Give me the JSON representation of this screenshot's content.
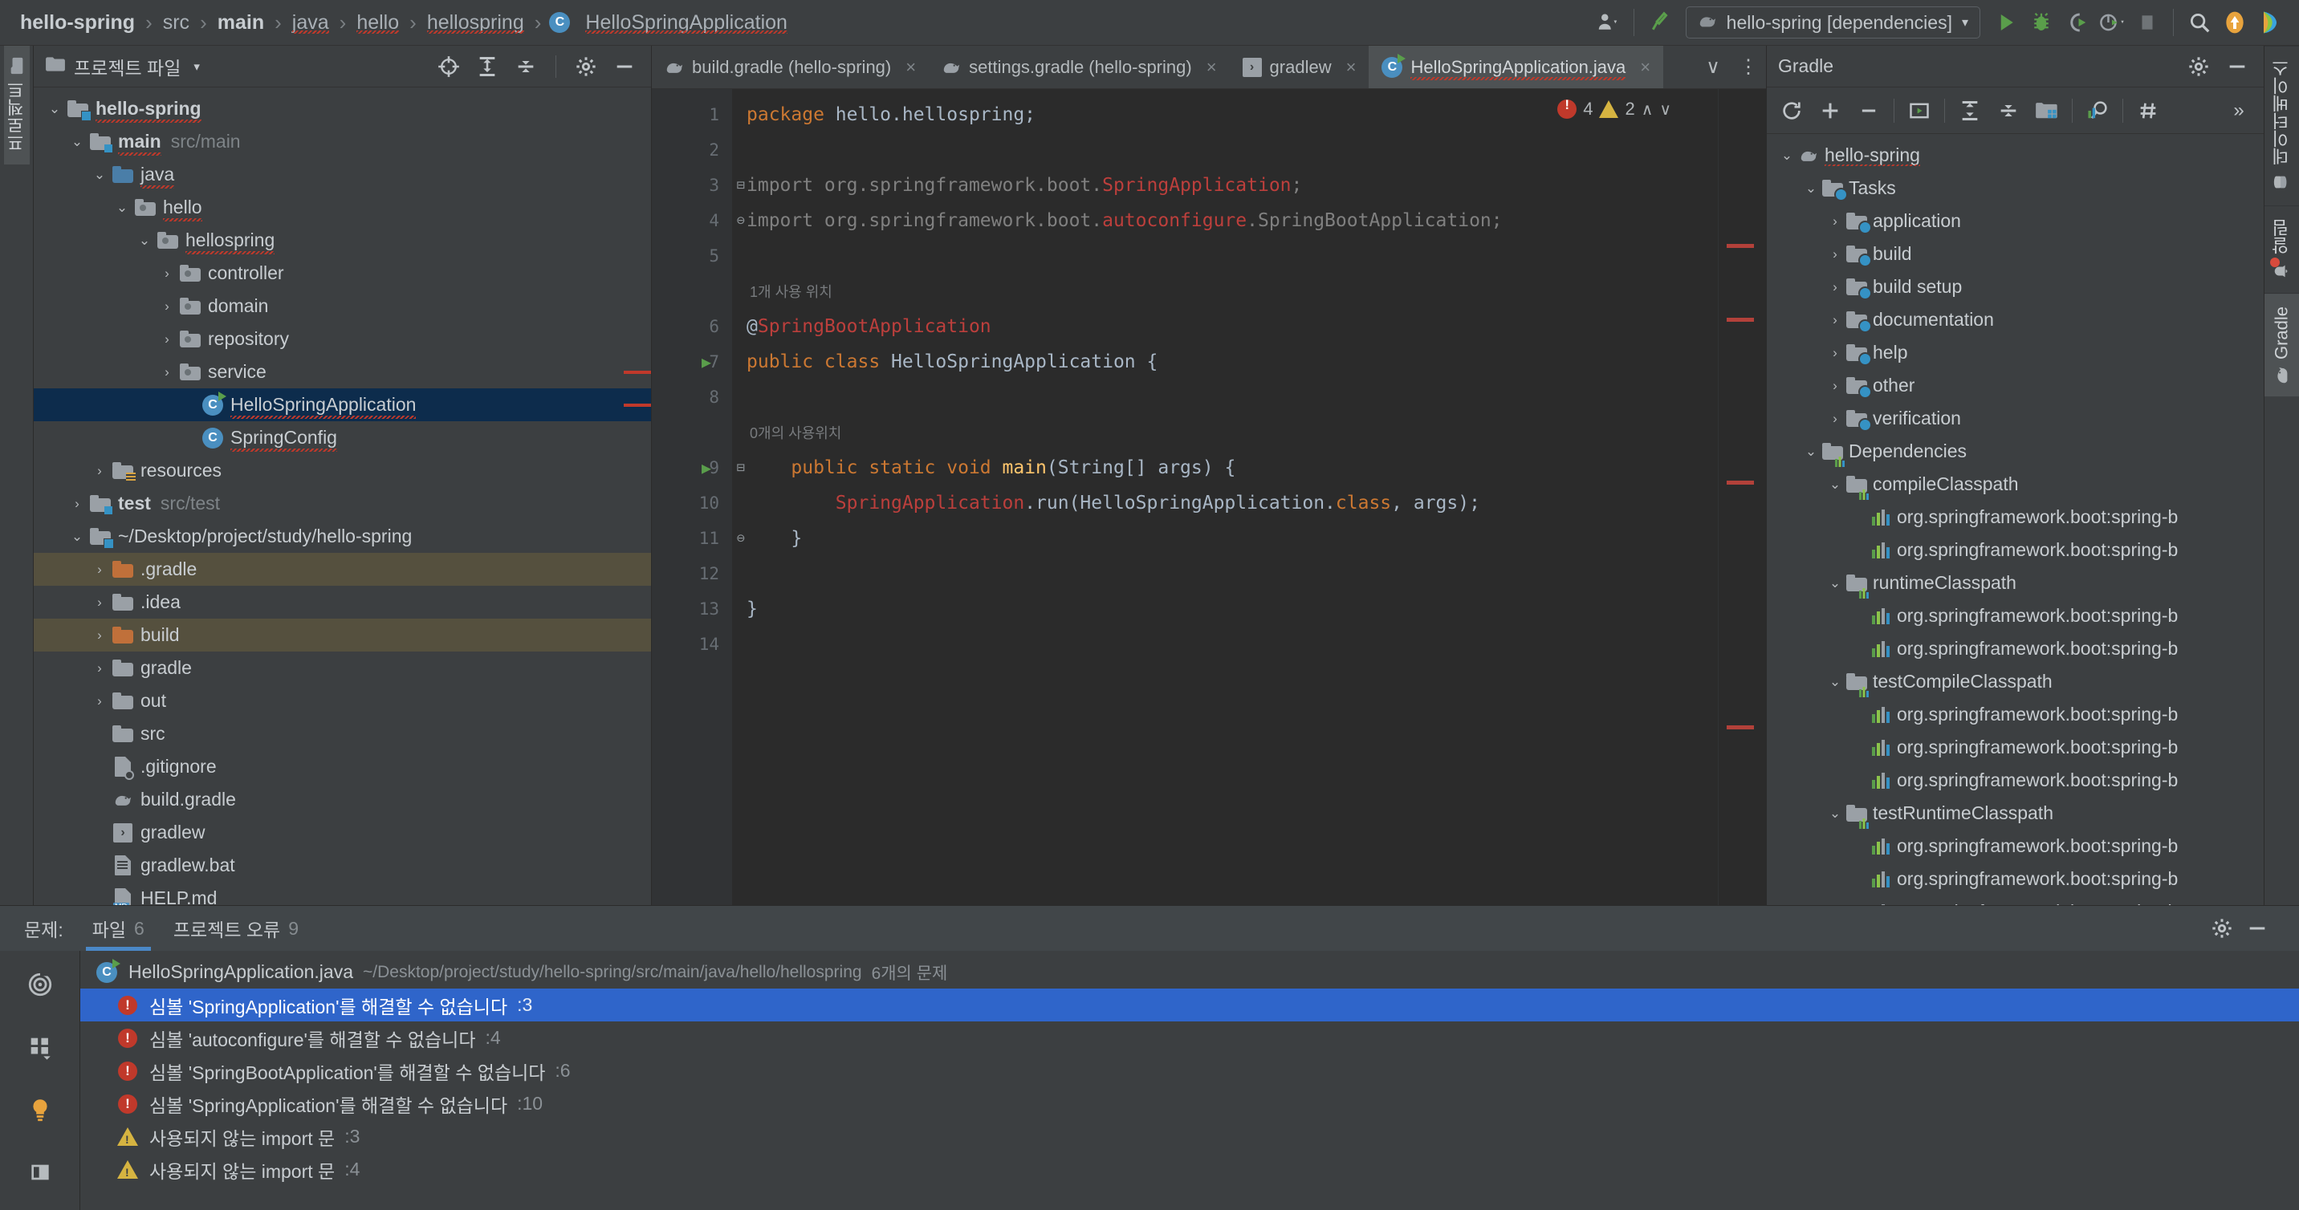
{
  "topbar": {
    "breadcrumb": [
      {
        "label": "hello-spring",
        "bold": true,
        "squiggle": false
      },
      {
        "label": "src",
        "bold": false,
        "squiggle": false
      },
      {
        "label": "main",
        "bold": true,
        "squiggle": false
      },
      {
        "label": "java",
        "bold": false,
        "squiggle": true
      },
      {
        "label": "hello",
        "bold": false,
        "squiggle": true
      },
      {
        "label": "hellospring",
        "bold": false,
        "squiggle": true
      },
      {
        "label": "HelloSpringApplication",
        "bold": false,
        "squiggle": true,
        "icon": "java-class-icon"
      }
    ],
    "separator": "›",
    "run_config": "hello-spring [dependencies]",
    "run_config_caret": "▾",
    "icons": [
      "account-icon",
      "hammer-build-icon",
      "run-icon",
      "debug-icon",
      "run-with-coverage-icon",
      "profiler-icon",
      "stop-icon",
      "search-everywhere-icon",
      "update-icon",
      "ide-feature-icon"
    ]
  },
  "left_strip": {
    "tabs": [
      {
        "label": "프로젝트",
        "icon": "project-folder-icon",
        "active": true
      }
    ]
  },
  "right_strip": {
    "tabs": [
      {
        "label": "데이터베이스",
        "icon": "database-icon",
        "active": false,
        "badge": false
      },
      {
        "label": "알림",
        "icon": "notification-bell-icon",
        "active": false,
        "badge": true
      },
      {
        "label": "Gradle",
        "icon": "gradle-elephant-icon",
        "active": true,
        "badge": false
      }
    ]
  },
  "project_panel": {
    "title": "프로젝트 파일",
    "title_caret": "▾",
    "header_icons": [
      "locate-file-icon",
      "expand-all-icon",
      "collapse-all-icon",
      "gear-icon",
      "hide-icon"
    ],
    "tree": [
      {
        "label": "hello-spring",
        "depth": 0,
        "arrow": "⌄",
        "icon": "module-folder-icon",
        "bold": true,
        "squiggle": true,
        "sub": "",
        "state": "none"
      },
      {
        "label": "main",
        "depth": 1,
        "arrow": "⌄",
        "icon": "source-folder-icon",
        "bold": true,
        "squiggle": true,
        "sub": "src/main",
        "state": "none"
      },
      {
        "label": "java",
        "depth": 2,
        "arrow": "⌄",
        "icon": "java-source-folder-icon",
        "bold": false,
        "squiggle": true,
        "sub": "",
        "state": "none"
      },
      {
        "label": "hello",
        "depth": 3,
        "arrow": "⌄",
        "icon": "package-icon",
        "bold": false,
        "squiggle": true,
        "sub": "",
        "state": "none"
      },
      {
        "label": "hellospring",
        "depth": 4,
        "arrow": "⌄",
        "icon": "package-icon",
        "bold": false,
        "squiggle": true,
        "sub": "",
        "state": "none"
      },
      {
        "label": "controller",
        "depth": 5,
        "arrow": "›",
        "icon": "package-icon",
        "bold": false,
        "squiggle": false,
        "sub": "",
        "state": "none"
      },
      {
        "label": "domain",
        "depth": 5,
        "arrow": "›",
        "icon": "package-icon",
        "bold": false,
        "squiggle": false,
        "sub": "",
        "state": "none"
      },
      {
        "label": "repository",
        "depth": 5,
        "arrow": "›",
        "icon": "package-icon",
        "bold": false,
        "squiggle": false,
        "sub": "",
        "state": "none"
      },
      {
        "label": "service",
        "depth": 5,
        "arrow": "›",
        "icon": "package-icon",
        "bold": false,
        "squiggle": false,
        "sub": "",
        "state": "none",
        "stripe": true
      },
      {
        "label": "HelloSpringApplication",
        "depth": 6,
        "arrow": "",
        "icon": "java-runnable-class-icon",
        "bold": false,
        "squiggle": true,
        "sub": "",
        "state": "selected",
        "stripe": true
      },
      {
        "label": "SpringConfig",
        "depth": 6,
        "arrow": "",
        "icon": "java-class-icon",
        "bold": false,
        "squiggle": true,
        "sub": "",
        "state": "none"
      },
      {
        "label": "resources",
        "depth": 2,
        "arrow": "›",
        "icon": "resources-folder-icon",
        "bold": false,
        "squiggle": false,
        "sub": "",
        "state": "none"
      },
      {
        "label": "test",
        "depth": 1,
        "arrow": "›",
        "icon": "test-source-folder-icon",
        "bold": true,
        "squiggle": false,
        "sub": "src/test",
        "state": "none"
      },
      {
        "label": "~/Desktop/project/study/hello-spring",
        "depth": 1,
        "arrow": "⌄",
        "icon": "module-folder-icon",
        "bold": false,
        "squiggle": false,
        "sub": "",
        "state": "none"
      },
      {
        "label": ".gradle",
        "depth": 2,
        "arrow": "›",
        "icon": "excluded-folder-icon",
        "bold": false,
        "squiggle": false,
        "sub": "",
        "state": "highlight"
      },
      {
        "label": ".idea",
        "depth": 2,
        "arrow": "›",
        "icon": "folder-icon",
        "bold": false,
        "squiggle": false,
        "sub": "",
        "state": "none"
      },
      {
        "label": "build",
        "depth": 2,
        "arrow": "›",
        "icon": "excluded-folder-icon",
        "bold": false,
        "squiggle": false,
        "sub": "",
        "state": "highlight"
      },
      {
        "label": "gradle",
        "depth": 2,
        "arrow": "›",
        "icon": "folder-icon",
        "bold": false,
        "squiggle": false,
        "sub": "",
        "state": "none"
      },
      {
        "label": "out",
        "depth": 2,
        "arrow": "›",
        "icon": "folder-icon",
        "bold": false,
        "squiggle": false,
        "sub": "",
        "state": "none"
      },
      {
        "label": "src",
        "depth": 2,
        "arrow": "",
        "icon": "folder-icon",
        "bold": false,
        "squiggle": false,
        "sub": "",
        "state": "none"
      },
      {
        "label": ".gitignore",
        "depth": 2,
        "arrow": "",
        "icon": "gitignore-file-icon",
        "bold": false,
        "squiggle": false,
        "sub": "",
        "state": "none"
      },
      {
        "label": "build.gradle",
        "depth": 2,
        "arrow": "",
        "icon": "gradle-elephant-icon",
        "bold": false,
        "squiggle": false,
        "sub": "",
        "state": "none"
      },
      {
        "label": "gradlew",
        "depth": 2,
        "arrow": "",
        "icon": "shell-script-icon",
        "bold": false,
        "squiggle": false,
        "sub": "",
        "state": "none"
      },
      {
        "label": "gradlew.bat",
        "depth": 2,
        "arrow": "",
        "icon": "batch-file-icon",
        "bold": false,
        "squiggle": false,
        "sub": "",
        "state": "none"
      },
      {
        "label": "HELP.md",
        "depth": 2,
        "arrow": "",
        "icon": "markdown-file-icon",
        "bold": false,
        "squiggle": false,
        "sub": "",
        "state": "none"
      }
    ]
  },
  "editor": {
    "tabs": [
      {
        "label": "build.gradle (hello-spring)",
        "icon": "gradle-elephant-icon",
        "active": false,
        "squiggle": false,
        "close": "×"
      },
      {
        "label": "settings.gradle (hello-spring)",
        "icon": "gradle-elephant-icon",
        "active": false,
        "squiggle": false,
        "close": "×"
      },
      {
        "label": "gradlew",
        "icon": "shell-script-icon",
        "active": false,
        "squiggle": false,
        "close": "×"
      },
      {
        "label": "HelloSpringApplication.java",
        "icon": "java-runnable-class-icon",
        "active": true,
        "squiggle": true,
        "close": "×"
      }
    ],
    "tab_overflow_icon": "chevron-down-icon",
    "tab_options_icon": "more-options-icon",
    "inspector": {
      "error_count": "4",
      "warning_count": "2",
      "up": "∧",
      "down": "∨"
    },
    "line_numbers": [
      "1",
      "2",
      "3",
      "4",
      "5",
      "6",
      "7",
      "8",
      "9",
      "10",
      "11",
      "12",
      "13",
      "14"
    ],
    "code": [
      {
        "n": "1",
        "hint": "",
        "runmark": false,
        "fold": "",
        "tokens": [
          {
            "t": "package ",
            "c": "kw"
          },
          {
            "t": "hello.hellospring;",
            "c": "plain"
          }
        ]
      },
      {
        "n": "2",
        "hint": "",
        "runmark": false,
        "fold": "",
        "tokens": []
      },
      {
        "n": "3",
        "hint": "",
        "runmark": false,
        "fold": "open",
        "tokens": [
          {
            "t": "import org.springframework.boot.",
            "c": "dim"
          },
          {
            "t": "SpringApplication",
            "c": "err"
          },
          {
            "t": ";",
            "c": "dim"
          }
        ]
      },
      {
        "n": "4",
        "hint": "",
        "runmark": false,
        "fold": "close",
        "tokens": [
          {
            "t": "import org.springframework.boot.",
            "c": "dim"
          },
          {
            "t": "autoconfigure",
            "c": "err"
          },
          {
            "t": ".SpringBootApplication;",
            "c": "dim"
          }
        ]
      },
      {
        "n": "5",
        "hint": "",
        "runmark": false,
        "fold": "",
        "tokens": []
      },
      {
        "n": "6",
        "hint": "1개 사용 위치",
        "runmark": false,
        "fold": "",
        "tokens": [
          {
            "t": "@",
            "c": "plain"
          },
          {
            "t": "SpringBootApplication",
            "c": "err"
          }
        ]
      },
      {
        "n": "7",
        "hint": "",
        "runmark": true,
        "fold": "",
        "tokens": [
          {
            "t": "public class ",
            "c": "kw"
          },
          {
            "t": "HelloSpringApplication",
            "c": "plain"
          },
          {
            "t": " {",
            "c": "plain"
          }
        ]
      },
      {
        "n": "8",
        "hint": "",
        "runmark": false,
        "fold": "",
        "tokens": []
      },
      {
        "n": "9",
        "hint": "0개의 사용위치",
        "runmark": true,
        "fold": "open",
        "tokens": [
          {
            "t": "    public static void ",
            "c": "kw"
          },
          {
            "t": "main",
            "c": "fn"
          },
          {
            "t": "(String[] args) {",
            "c": "plain"
          }
        ]
      },
      {
        "n": "10",
        "hint": "",
        "runmark": false,
        "fold": "",
        "tokens": [
          {
            "t": "        ",
            "c": "plain"
          },
          {
            "t": "SpringApplication",
            "c": "err"
          },
          {
            "t": ".run(HelloSpringApplication.",
            "c": "plain"
          },
          {
            "t": "class",
            "c": "kw"
          },
          {
            "t": ", args);",
            "c": "plain"
          }
        ]
      },
      {
        "n": "11",
        "hint": "",
        "runmark": false,
        "fold": "close",
        "tokens": [
          {
            "t": "    }",
            "c": "plain"
          }
        ]
      },
      {
        "n": "12",
        "hint": "",
        "runmark": false,
        "fold": "",
        "tokens": []
      },
      {
        "n": "13",
        "hint": "",
        "runmark": false,
        "fold": "",
        "tokens": [
          {
            "t": "}",
            "c": "plain"
          }
        ]
      },
      {
        "n": "14",
        "hint": "",
        "runmark": false,
        "fold": "",
        "tokens": []
      }
    ],
    "stripe_marks_pct": [
      19,
      28,
      48,
      78
    ]
  },
  "gradle_panel": {
    "title": "Gradle",
    "header_icons": [
      "gear-icon",
      "hide-icon"
    ],
    "toolbar_icons": [
      "reload-all-gradle-projects-icon",
      "add-icon",
      "remove-icon",
      "run-task-icon",
      "expand-all-icon",
      "collapse-all-icon",
      "toggle-offline-icon",
      "execute-gradle-task-icon",
      "show-ignored-icon",
      "more-icon"
    ],
    "tree": [
      {
        "label": "hello-spring",
        "depth": 0,
        "arrow": "⌄",
        "icon": "gradle-elephant-icon",
        "squiggle": true
      },
      {
        "label": "Tasks",
        "depth": 1,
        "arrow": "⌄",
        "icon": "task-folder-icon",
        "squiggle": false
      },
      {
        "label": "application",
        "depth": 2,
        "arrow": "›",
        "icon": "task-folder-icon",
        "squiggle": false
      },
      {
        "label": "build",
        "depth": 2,
        "arrow": "›",
        "icon": "task-folder-icon",
        "squiggle": false
      },
      {
        "label": "build setup",
        "depth": 2,
        "arrow": "›",
        "icon": "task-folder-icon",
        "squiggle": false
      },
      {
        "label": "documentation",
        "depth": 2,
        "arrow": "›",
        "icon": "task-folder-icon",
        "squiggle": false
      },
      {
        "label": "help",
        "depth": 2,
        "arrow": "›",
        "icon": "task-folder-icon",
        "squiggle": false
      },
      {
        "label": "other",
        "depth": 2,
        "arrow": "›",
        "icon": "task-folder-icon",
        "squiggle": false
      },
      {
        "label": "verification",
        "depth": 2,
        "arrow": "›",
        "icon": "task-folder-icon",
        "squiggle": false
      },
      {
        "label": "Dependencies",
        "depth": 1,
        "arrow": "⌄",
        "icon": "dependency-folder-icon",
        "squiggle": false
      },
      {
        "label": "compileClasspath",
        "depth": 2,
        "arrow": "⌄",
        "icon": "dependency-folder-icon",
        "squiggle": false
      },
      {
        "label": "org.springframework.boot:spring-b",
        "depth": 3,
        "arrow": "",
        "icon": "library-icon",
        "squiggle": false
      },
      {
        "label": "org.springframework.boot:spring-b",
        "depth": 3,
        "arrow": "",
        "icon": "library-icon",
        "squiggle": false
      },
      {
        "label": "runtimeClasspath",
        "depth": 2,
        "arrow": "⌄",
        "icon": "dependency-folder-icon",
        "squiggle": false
      },
      {
        "label": "org.springframework.boot:spring-b",
        "depth": 3,
        "arrow": "",
        "icon": "library-icon",
        "squiggle": false
      },
      {
        "label": "org.springframework.boot:spring-b",
        "depth": 3,
        "arrow": "",
        "icon": "library-icon",
        "squiggle": false
      },
      {
        "label": "testCompileClasspath",
        "depth": 2,
        "arrow": "⌄",
        "icon": "dependency-folder-icon",
        "squiggle": false
      },
      {
        "label": "org.springframework.boot:spring-b",
        "depth": 3,
        "arrow": "",
        "icon": "library-icon",
        "squiggle": false
      },
      {
        "label": "org.springframework.boot:spring-b",
        "depth": 3,
        "arrow": "",
        "icon": "library-icon",
        "squiggle": false
      },
      {
        "label": "org.springframework.boot:spring-b",
        "depth": 3,
        "arrow": "",
        "icon": "library-icon",
        "squiggle": false
      },
      {
        "label": "testRuntimeClasspath",
        "depth": 2,
        "arrow": "⌄",
        "icon": "dependency-folder-icon",
        "squiggle": false
      },
      {
        "label": "org.springframework.boot:spring-b",
        "depth": 3,
        "arrow": "",
        "icon": "library-icon",
        "squiggle": false
      },
      {
        "label": "org.springframework.boot:spring-b",
        "depth": 3,
        "arrow": "",
        "icon": "library-icon",
        "squiggle": false
      },
      {
        "label": "org.springframework.boot:spring-b",
        "depth": 3,
        "arrow": "",
        "icon": "library-icon",
        "squiggle": false
      }
    ]
  },
  "problems_panel": {
    "label": "문제:",
    "tabs": [
      {
        "label": "파일",
        "count": "6",
        "active": true
      },
      {
        "label": "프로젝트 오류",
        "count": "9",
        "active": false
      }
    ],
    "header_icons": [
      "gear-icon",
      "hide-icon"
    ],
    "strip_icons": [
      "inspection-scope-icon",
      "group-by-icon",
      "quick-fix-bulb-icon",
      "preview-panel-icon"
    ],
    "file_row": {
      "name": "HelloSpringApplication.java",
      "path": "~/Desktop/project/study/hello-spring/src/main/java/hello/hellospring",
      "count": "6개의 문제",
      "icon": "java-runnable-class-icon"
    },
    "items": [
      {
        "severity": "error",
        "text": "심볼 'SpringApplication'를 해결할 수 없습니다",
        "line": ":3",
        "selected": true
      },
      {
        "severity": "error",
        "text": "심볼 'autoconfigure'를 해결할 수 없습니다",
        "line": ":4",
        "selected": false
      },
      {
        "severity": "error",
        "text": "심볼 'SpringBootApplication'를 해결할 수 없습니다",
        "line": ":6",
        "selected": false
      },
      {
        "severity": "error",
        "text": "심볼 'SpringApplication'를 해결할 수 없습니다",
        "line": ":10",
        "selected": false
      },
      {
        "severity": "warning",
        "text": "사용되지 않는 import 문",
        "line": ":3",
        "selected": false
      },
      {
        "severity": "warning",
        "text": "사용되지 않는 import 문",
        "line": ":4",
        "selected": false
      }
    ]
  },
  "colors": {
    "accent_blue": "#2f65ca",
    "error_red": "#c0392b",
    "warning_yellow": "#d6b441",
    "run_green": "#5a9e4b",
    "panel_bg": "#3c3f41",
    "editor_bg": "#2b2b2b",
    "selection_navy": "#0d2c4c"
  }
}
